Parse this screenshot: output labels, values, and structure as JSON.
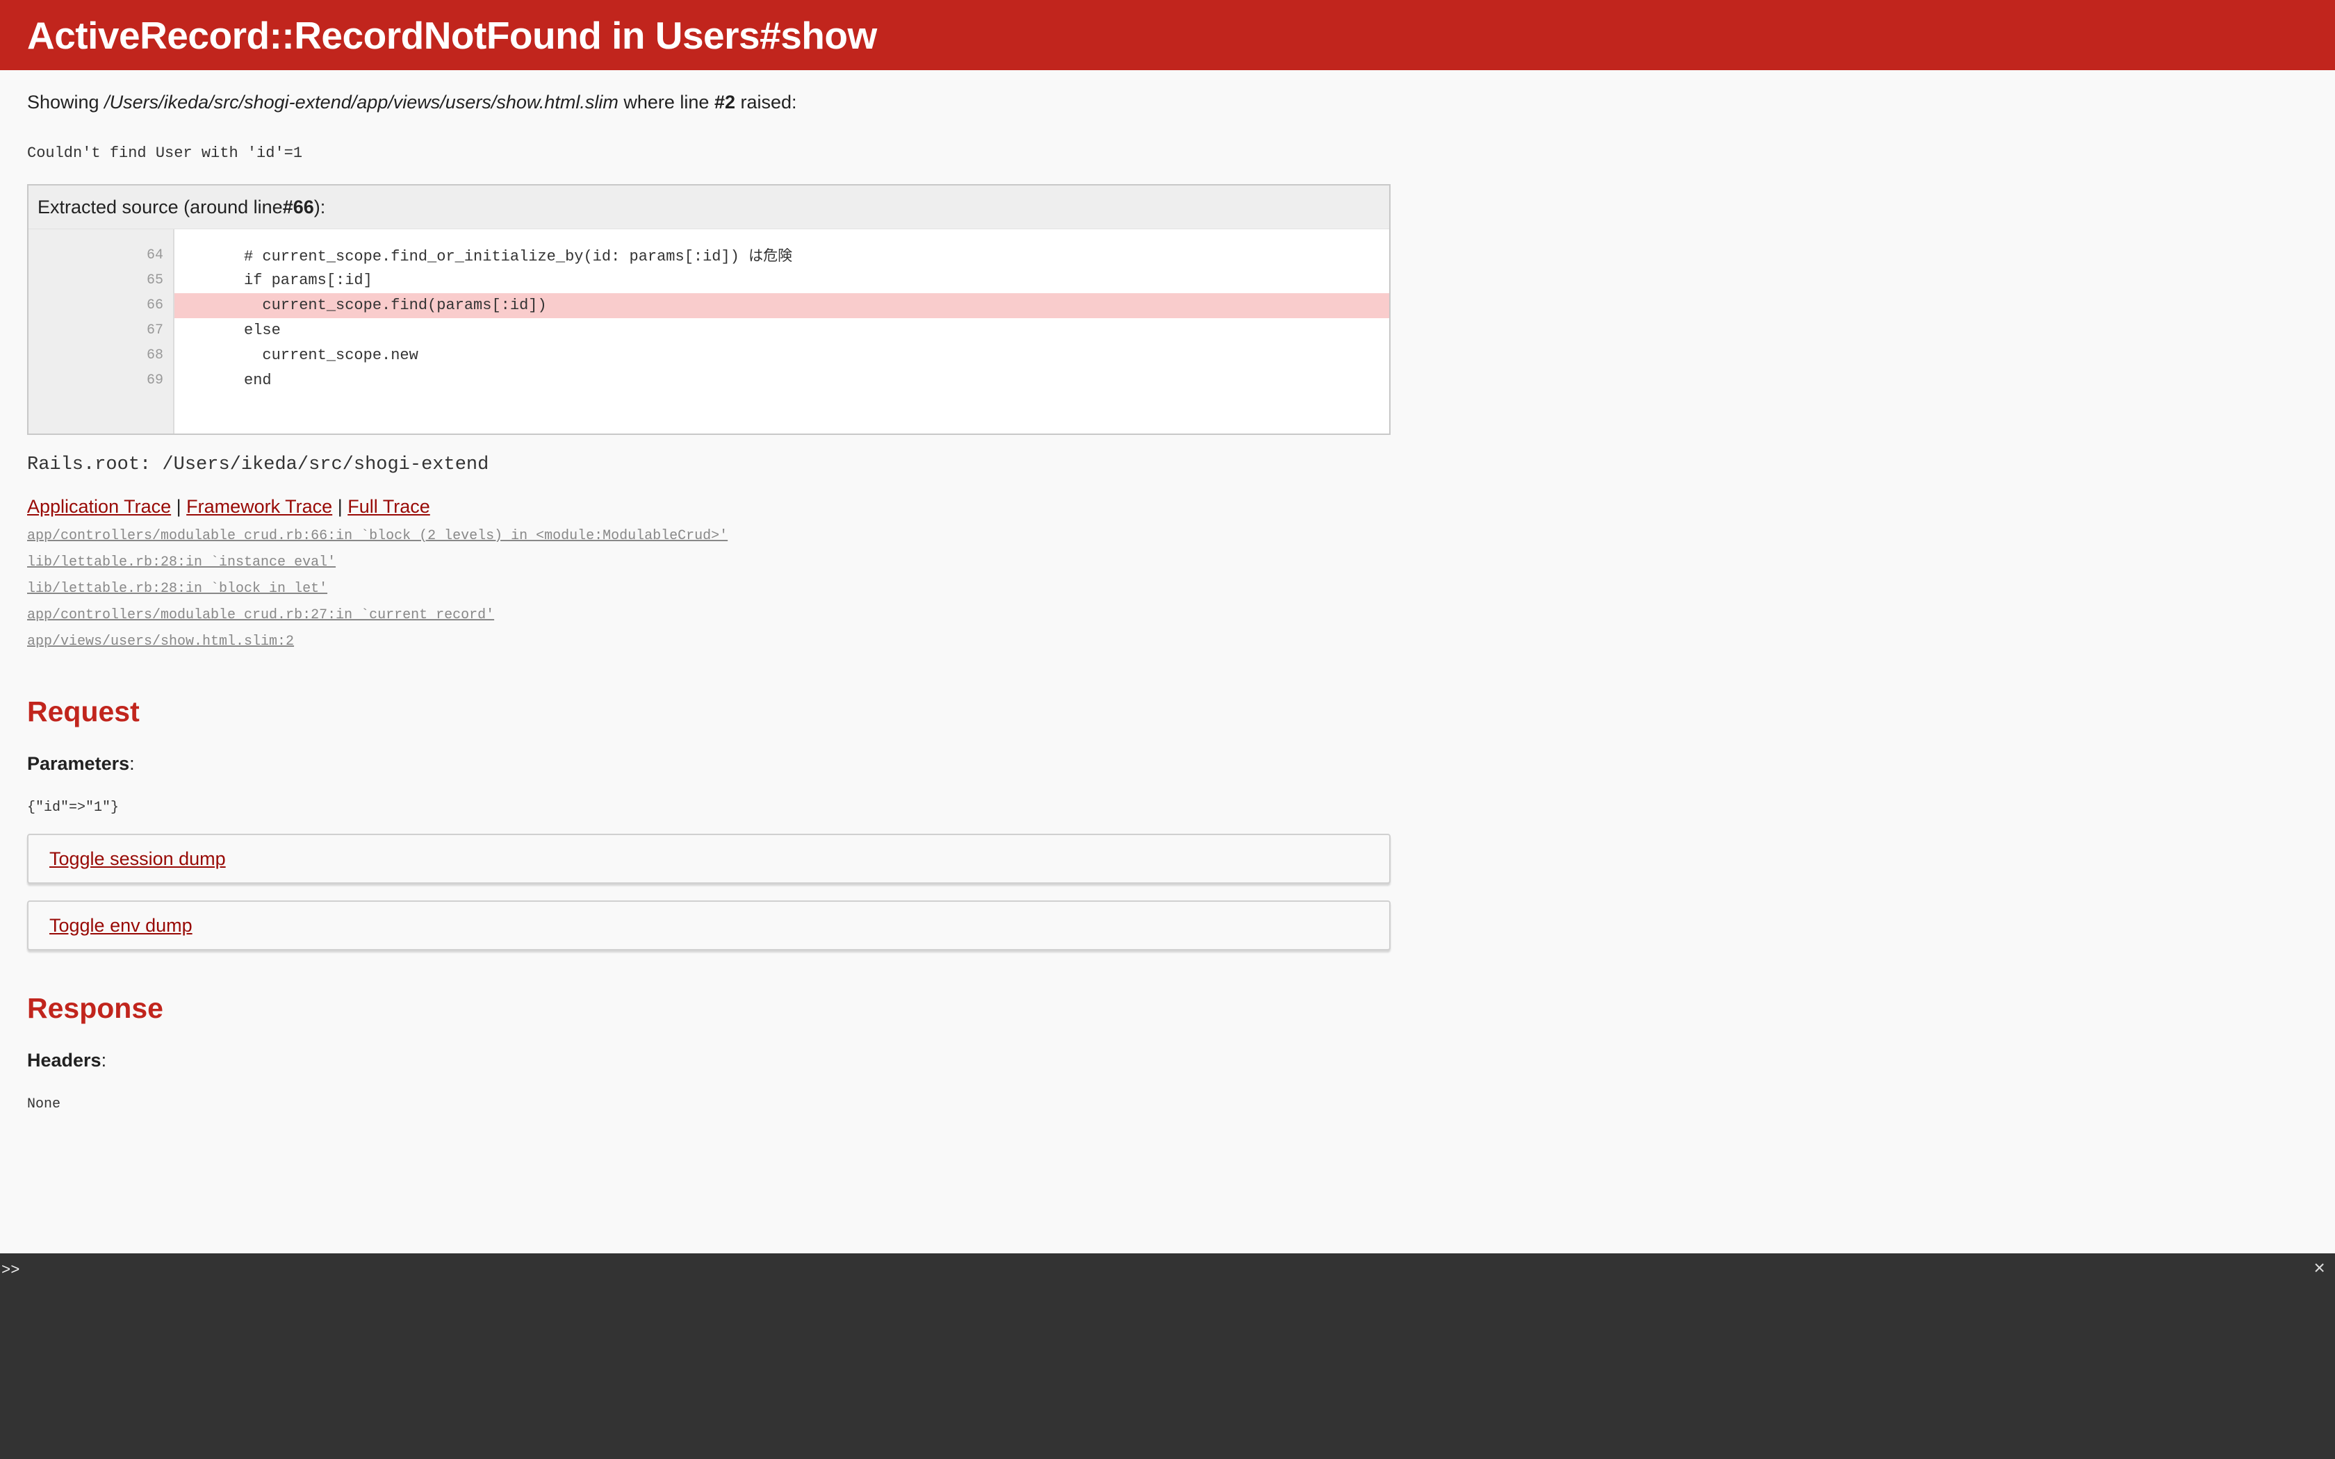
{
  "header": {
    "title": "ActiveRecord::RecordNotFound in Users#show"
  },
  "showing": {
    "prefix": "Showing ",
    "path": "/Users/ikeda/src/shogi-extend/app/views/users/show.html.slim",
    "middle": " where line ",
    "line": "#2",
    "suffix": " raised:"
  },
  "message": "Couldn't find User with 'id'=1",
  "source": {
    "title_prefix": "Extracted source (around line ",
    "title_line": "#66",
    "title_suffix": "):",
    "line_numbers": [
      "64",
      "65",
      "66",
      "67",
      "68",
      "69"
    ],
    "lines": [
      "# current_scope.find_or_initialize_by(id: params[:id]) ",
      "if params[:id]",
      "  current_scope.find(params[:id])",
      "else",
      "  current_scope.new",
      "end"
    ],
    "line0_jp": "は危険"
  },
  "rails_root": "Rails.root: /Users/ikeda/src/shogi-extend",
  "trace": {
    "application": "Application Trace",
    "framework": "Framework Trace",
    "full": "Full Trace",
    "separator": " | ",
    "lines": [
      "app/controllers/modulable_crud.rb:66:in `block (2 levels) in <module:ModulableCrud>'",
      "lib/lettable.rb:28:in `instance_eval'",
      "lib/lettable.rb:28:in `block in let'",
      "app/controllers/modulable_crud.rb:27:in `current_record'",
      "app/views/users/show.html.slim:2"
    ]
  },
  "request": {
    "title": "Request",
    "params_label": "Parameters",
    "colon": ":",
    "params_value": "{\"id\"=>\"1\"}",
    "toggle_session": "Toggle session dump",
    "toggle_env": "Toggle env dump"
  },
  "response": {
    "title": "Response",
    "headers_label": "Headers",
    "colon": ":",
    "headers_value": "None"
  },
  "console": {
    "prompt": ">>",
    "close": "×"
  },
  "colors": {
    "accent": "#c1251d",
    "link": "#980905",
    "highlight": "#f9cccc",
    "console_bg": "#333333"
  }
}
